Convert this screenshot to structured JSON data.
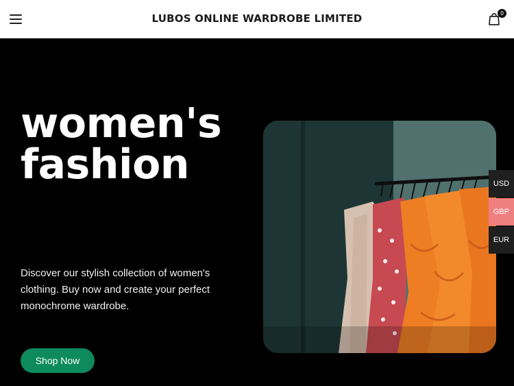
{
  "header": {
    "title": "LUBOS ONLINE WARDROBE LIMITED",
    "cart_count": "0",
    "menu_icon": "hamburger-menu-icon",
    "cart_icon": "shopping-bag-icon"
  },
  "hero": {
    "title_line1": "women's",
    "title_line2": "fashion",
    "description": "Discover our stylish collection of women's clothing. Buy now and create your perfect monochrome wardrobe.",
    "button_label": "Shop Now",
    "image_alt": "clothing rack photo"
  },
  "currencies": [
    {
      "code": "USD",
      "active": false
    },
    {
      "code": "GBP",
      "active": true
    },
    {
      "code": "EUR",
      "active": false
    }
  ],
  "colors": {
    "hero_background": "#000000",
    "button": "#0e8a5f",
    "active_currency": "#f08080",
    "inactive_currency": "#1f1f1f"
  }
}
